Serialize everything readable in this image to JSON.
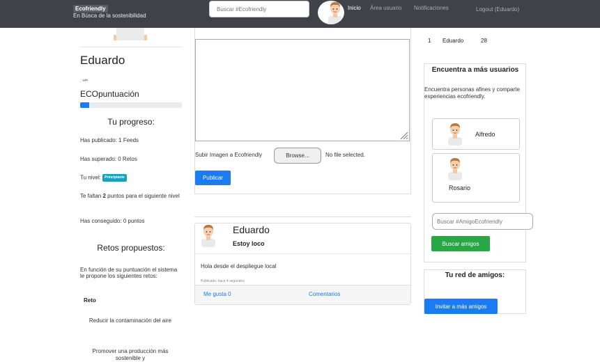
{
  "navbar": {
    "brand": "Ecofriendly",
    "tagline": "En Búsca de la sostenibilidad",
    "search_placeholder": "Buscar #Ecofriendly",
    "links": {
      "inicio": "Inicio",
      "area": "Área usuario",
      "notificaciones": "Notificaciones",
      "logout": "Logout (Eduardo)"
    }
  },
  "profile": {
    "name": "Eduardo",
    "small_text": ": ᵃᵈᵐ",
    "eco_label": "ECOpuntuación",
    "eco_progress_percent": 9,
    "progress_heading": "Tu progreso:",
    "publicado": "Has publicado: 1 Feeds",
    "superado": "Has superado: 0 Retos",
    "nivel_label": "Tu nivel:",
    "nivel_badge": "Principiante",
    "faltan_prefix": "Te faltan ",
    "faltan_num": "2",
    "faltan_suffix": " puntos para el siguiente nivel",
    "conseguido": "Has conseguido: 0 puntos"
  },
  "retos": {
    "heading": "Retos propuestos:",
    "description": "En función de su puntuación el sistema le propone los siguientes retos:",
    "column": "Reto",
    "items": [
      "Reducir la contaminación del aire",
      "Promover una producción más sostenible y"
    ]
  },
  "composer": {
    "upload_label": "Subir Imagen a Ecofriendly",
    "browse": "Browse...",
    "no_file": "No file selected.",
    "publish": "Publicar"
  },
  "feed": {
    "author": "Eduardo",
    "title": "Estoy loco",
    "body": "Hola desde el despliegue local",
    "meta": "Publicado: hace 4 segundos",
    "like": "Me gusta 0",
    "comments": "Comentarios"
  },
  "ranking": {
    "position": "1",
    "name": "Eduardo",
    "points": "28"
  },
  "find": {
    "title": "Encuentra a más usuarios",
    "description": "Encuentra personas afines y comparte experiencias ecofriendly.",
    "friends": [
      "Alfredo",
      "Rosario"
    ],
    "search_placeholder": "Buscar #AmigoEcofriendly",
    "button": "Buscar amigos"
  },
  "network": {
    "title": "Tu red de amigos:",
    "invite": "Invitar a más amigos"
  },
  "colors": {
    "navbar": "#3f4349",
    "primary": "#1a7bf2",
    "success": "#28a745",
    "info": "#17a2b8"
  }
}
